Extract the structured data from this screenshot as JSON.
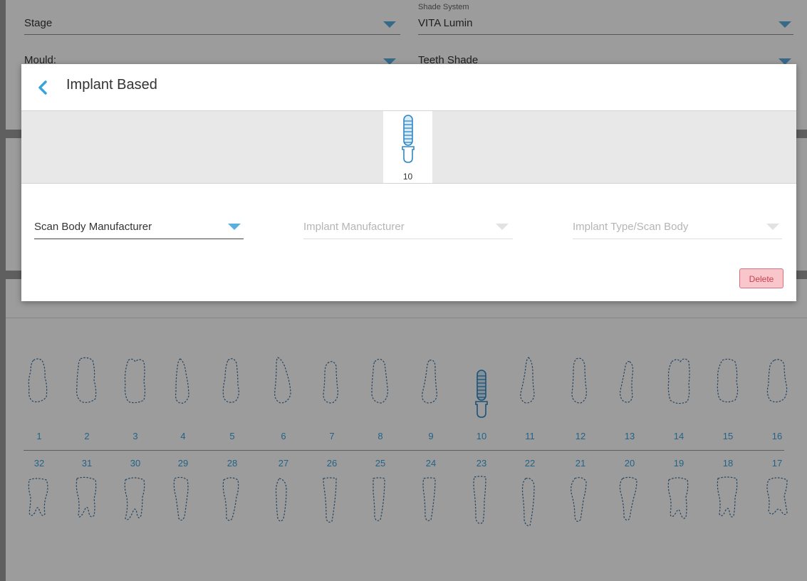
{
  "background_form": {
    "stage_label": "Stage",
    "shade_system_caption": "Shade System",
    "shade_system_value": "VITA Lumin",
    "mould_label": "Mould:",
    "teeth_shade_label": "Teeth Shade"
  },
  "tooth_chart": {
    "upper_numbers": [
      "1",
      "2",
      "3",
      "4",
      "5",
      "6",
      "7",
      "8",
      "9",
      "10",
      "11",
      "12",
      "13",
      "14",
      "15",
      "16"
    ],
    "lower_numbers": [
      "32",
      "31",
      "30",
      "29",
      "28",
      "27",
      "26",
      "25",
      "24",
      "23",
      "22",
      "21",
      "20",
      "19",
      "18",
      "17"
    ],
    "implant_tooth": "10"
  },
  "modal": {
    "title": "Implant Based",
    "selected_tooth_number": "10",
    "scan_body_manufacturer": "Scan Body Manufacturer",
    "implant_manufacturer": "Implant Manufacturer",
    "implant_type": "Implant Type/Scan Body",
    "delete_label": "Delete"
  },
  "colors": {
    "accent": "#3aa3dc",
    "delete_bg": "#f9c6cc",
    "delete_text": "#c8404f"
  }
}
